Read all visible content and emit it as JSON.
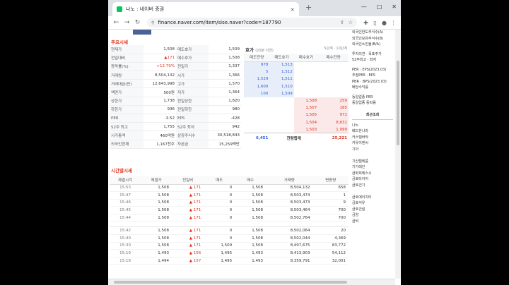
{
  "browser": {
    "tab_title": "나노 : 네이버 증권",
    "tab_close": "×",
    "new_tab": "+",
    "url": "finance.naver.com/item/sise.naver?code=187790",
    "window_controls": [
      "—",
      "□",
      "✕"
    ]
  },
  "quote": {
    "title": "주요시세",
    "left": [
      {
        "label": "현재가",
        "value": "1,508",
        "color": "black"
      },
      {
        "label": "전일대비",
        "value": "▲171",
        "color": "red"
      },
      {
        "label": "등락률(%)",
        "value": "+12.79%",
        "color": "red"
      },
      {
        "label": "거래량",
        "value": "8,504,132",
        "color": "black"
      },
      {
        "label": "거래대금(만)",
        "value": "12,643,998",
        "color": "black"
      },
      {
        "label": "액면가",
        "value": "500원",
        "color": "black"
      },
      {
        "label": "상한가",
        "value": "1,738",
        "color": "black"
      },
      {
        "label": "하한가",
        "value": "936",
        "color": "black"
      },
      {
        "label": "PER",
        "value": "-3.52",
        "color": "black"
      },
      {
        "label": "52주 최고",
        "value": "1,755",
        "color": "black"
      },
      {
        "label": "시가총액",
        "value": "460억원",
        "color": "black"
      },
      {
        "label": "외국인현재",
        "value": "1,167천주",
        "color": "black"
      }
    ],
    "right": [
      {
        "label": "매도호가",
        "value": "1,509"
      },
      {
        "label": "매수호가",
        "value": "1,508"
      },
      {
        "label": "전일가",
        "value": "1,337"
      },
      {
        "label": "시가",
        "value": "1,366"
      },
      {
        "label": "고가",
        "value": "1,570"
      },
      {
        "label": "저가",
        "value": "1,364"
      },
      {
        "label": "전일상한",
        "value": "1,820"
      },
      {
        "label": "전일하한",
        "value": "980"
      },
      {
        "label": "EPS",
        "value": "-428"
      },
      {
        "label": "52주 최저",
        "value": "942"
      },
      {
        "label": "상장주식수",
        "value": "30,518,843"
      },
      {
        "label": "자본금",
        "value": "15,259백만"
      }
    ]
  },
  "hoga": {
    "title": "호가",
    "subtitle": "(20분 지연)",
    "options": "5단계 · 10단계",
    "headers": [
      "매도잔량",
      "매도호가",
      "매수호가",
      "매수잔량"
    ],
    "sell": [
      {
        "qty": "978",
        "price": "1,513"
      },
      {
        "qty": "5",
        "price": "1,512"
      },
      {
        "qty": "1,529",
        "price": "1,511"
      },
      {
        "qty": "1,600",
        "price": "1,510"
      },
      {
        "qty": "100",
        "price": "1,509"
      }
    ],
    "buy": [
      {
        "price": "1,508",
        "qty": "259"
      },
      {
        "price": "1,507",
        "qty": "185"
      },
      {
        "price": "1,505",
        "qty": "971"
      },
      {
        "price": "1,504",
        "qty": "8,631"
      },
      {
        "price": "1,503",
        "qty": "1,999"
      }
    ],
    "total": {
      "sell": "6,451",
      "label": "잔량합계",
      "buy": "25,221"
    }
  },
  "timeseries": {
    "title": "시간별시세",
    "headers": [
      "체결시각",
      "체결가",
      "전일비",
      "매도",
      "매수",
      "거래량",
      "변동량"
    ],
    "rows": [
      {
        "t": "15:53",
        "price": "1,508",
        "chg": "▲ 171",
        "sell": "0",
        "buy": "1,508",
        "vol": "8,504,132",
        "delta": "658"
      },
      {
        "t": "15:47",
        "price": "1,508",
        "chg": "▲ 171",
        "sell": "0",
        "buy": "1,508",
        "vol": "8,503,474",
        "delta": "1"
      },
      {
        "t": "15:46",
        "price": "1,508",
        "chg": "▲ 171",
        "sell": "0",
        "buy": "1,508",
        "vol": "8,503,473",
        "delta": "9"
      },
      {
        "t": "15:45",
        "price": "1,508",
        "chg": "▲ 171",
        "sell": "0",
        "buy": "1,508",
        "vol": "8,503,464",
        "delta": "700"
      },
      {
        "t": "15:44",
        "price": "1,508",
        "chg": "▲ 171",
        "sell": "0",
        "buy": "1,508",
        "vol": "8,502,764",
        "delta": "700"
      },
      {
        "t": "15:42",
        "price": "1,508",
        "chg": "▲ 171",
        "sell": "0",
        "buy": "1,508",
        "vol": "8,502,064",
        "delta": "20"
      },
      {
        "t": "15:40",
        "price": "1,508",
        "chg": "▲ 171",
        "sell": "0",
        "buy": "1,508",
        "vol": "8,502,044",
        "delta": "4,369"
      },
      {
        "t": "15:30",
        "price": "1,508",
        "chg": "▲ 171",
        "sell": "1,509",
        "buy": "1,508",
        "vol": "8,497,675",
        "delta": "83,772"
      },
      {
        "t": "15:19",
        "price": "1,493",
        "chg": "▲ 156",
        "sell": "1,495",
        "buy": "1,493",
        "vol": "8,413,903",
        "delta": "54,112"
      },
      {
        "t": "15:18",
        "price": "1,494",
        "chg": "▲ 157",
        "sell": "1,495",
        "buy": "1,493",
        "vol": "8,359,791",
        "delta": "32,001"
      }
    ]
  },
  "sidebar": {
    "top": [
      "외국인한도주식수(A)",
      "외국인보유주식수(B)",
      "외국인소진율(B/A)"
    ],
    "mid": [
      "투자의견 · 목표주가",
      "52주최고 · 최저"
    ],
    "per": [
      "PER · EPS(2023.03)",
      "추정PER · EPS",
      "PBR · BPS(2023.03)",
      "배당수익률"
    ],
    "industry": [
      "동일업종 PER",
      "동일업종 등락률"
    ],
    "recent_title": "최근조회",
    "recent": [
      "나노",
      "베드한나라",
      "카스텔바작",
      "카유이엔씨",
      "기아",
      "",
      "기산텔레콤",
      "기가레인",
      "금화피에스시",
      "금호타이어",
      "금호건기",
      "",
      "금호에이치티",
      "금호석유",
      "금호건설",
      "금양",
      "금비"
    ]
  }
}
